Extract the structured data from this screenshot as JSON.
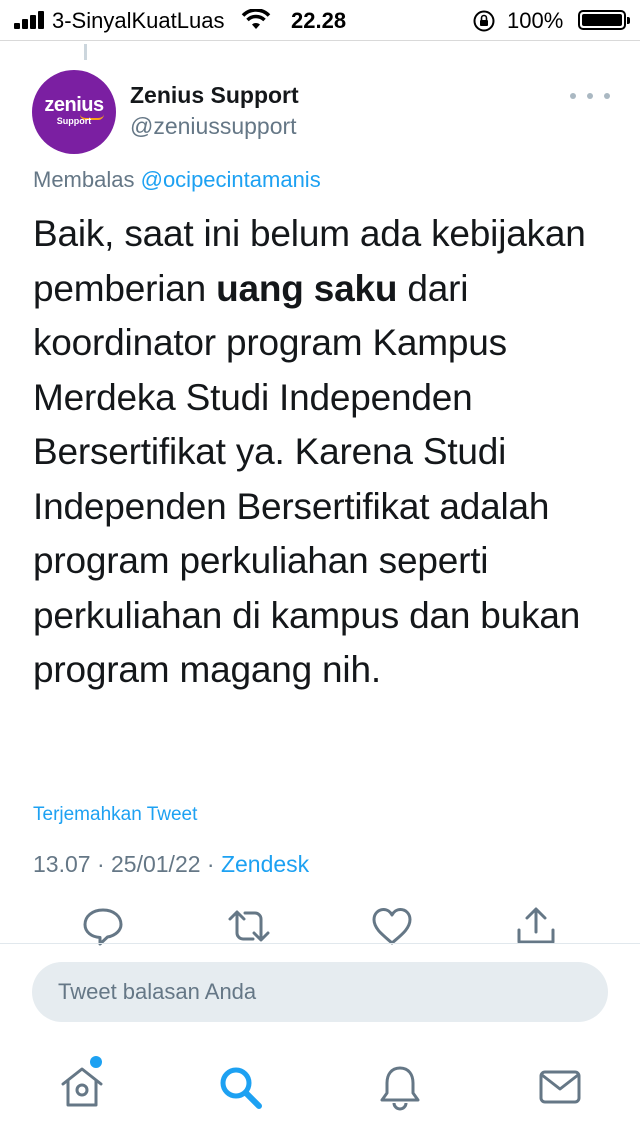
{
  "status_bar": {
    "carrier": "3-SinyalKuatLuas",
    "time": "22.28",
    "battery_percent": "100%",
    "battery_level": 1.0
  },
  "tweet": {
    "author_name": "Zenius Support",
    "author_handle": "@zeniussupport",
    "avatar": {
      "brand_word": "zenius",
      "brand_sub": "Support",
      "color": "#7b1fa2"
    },
    "reply_prefix": "Membalas",
    "reply_to": "@ocipecintamanis",
    "text_before_bold": "Baik, saat ini belum ada kebijakan pemberian ",
    "text_bold": "uang saku",
    "text_after_bold": " dari koordinator program Kampus Merdeka Studi Independen Bersertifikat ya. Karena Studi Independen Bersertifikat adalah program perkuliahan seperti perkuliahan di kampus dan bukan program magang nih.",
    "translate_label": "Terjemahkan Tweet",
    "timestamp": "13.07 · 25/01/22 · ",
    "source": "Zendesk"
  },
  "actions": {
    "icons": [
      "reply-icon",
      "retweet-icon",
      "like-icon",
      "share-icon"
    ]
  },
  "compose": {
    "placeholder": "Tweet balasan Anda"
  },
  "bottom_nav": {
    "items": [
      "home-icon",
      "search-icon",
      "notifications-icon",
      "messages-icon"
    ],
    "active": "search-icon"
  },
  "colors": {
    "accent": "#1da1f2",
    "secondary_text": "#657786",
    "primary_text": "#14171a",
    "icon_gray": "#657786"
  }
}
